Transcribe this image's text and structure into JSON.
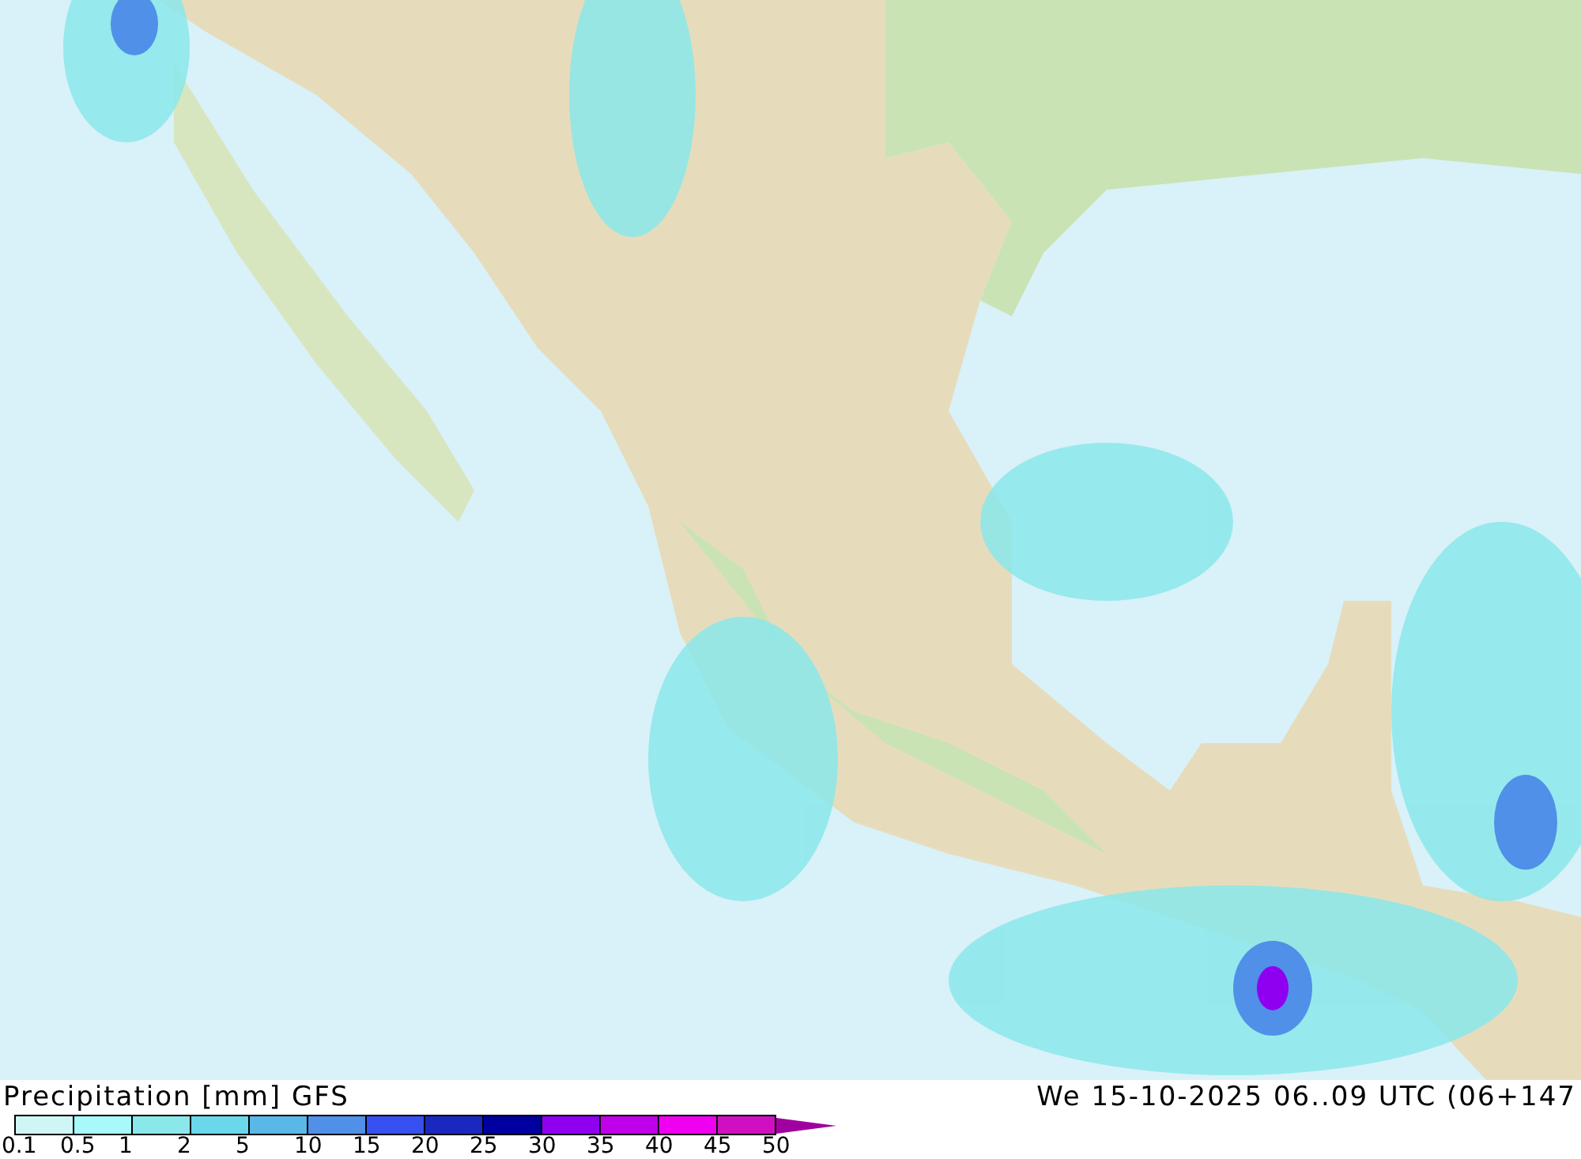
{
  "footer": {
    "title": "Precipitation [mm] GFS",
    "valid_time": "We 15-10-2025 06..09 UTC (06+147"
  },
  "legend": {
    "bins": [
      {
        "color": "#d0f5f5"
      },
      {
        "color": "#a8fafa"
      },
      {
        "color": "#8ae8ea"
      },
      {
        "color": "#6ad8ea"
      },
      {
        "color": "#5ab8e8"
      },
      {
        "color": "#5090e8"
      },
      {
        "color": "#3850f0"
      },
      {
        "color": "#1a28c0"
      },
      {
        "color": "#0000a0"
      },
      {
        "color": "#9000f0"
      },
      {
        "color": "#c000e8"
      },
      {
        "color": "#f000f0"
      },
      {
        "color": "#d010c0"
      },
      {
        "kind": "arrow",
        "color": "#a000a0"
      }
    ],
    "labels": [
      "0.1",
      "0.5",
      "1",
      "2",
      "5",
      "10",
      "15",
      "20",
      "25",
      "30",
      "35",
      "40",
      "45",
      "50"
    ]
  }
}
